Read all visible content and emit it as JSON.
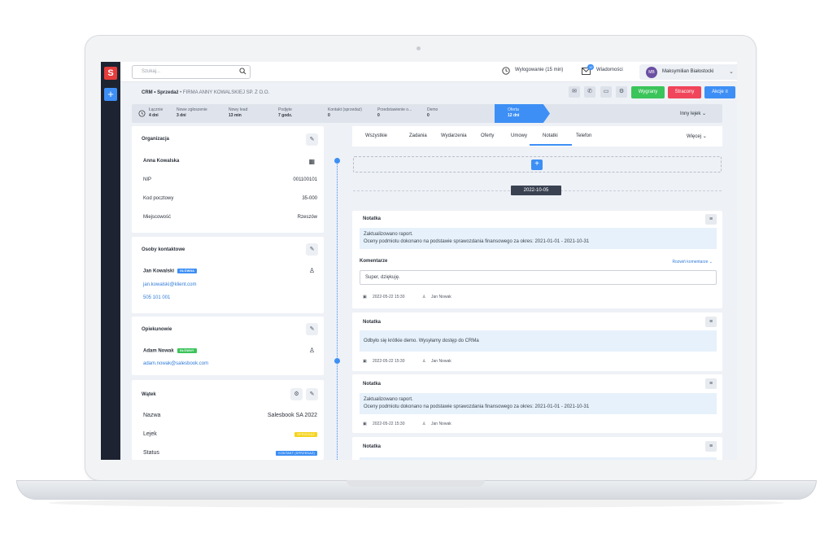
{
  "topbar": {
    "search_placeholder": "Szukaj...",
    "logout_label": "Wylogowanie (15 min)",
    "messages_label": "Wiadomości",
    "messages_badge": "12",
    "user_initials": "MB",
    "user_name": "Maksymilian Białostocki"
  },
  "breadcrumb": {
    "module": "CRM",
    "section": "Sprzedaż",
    "company": "FIRMA ANNY KOWALSKIEJ SP. Z O.O."
  },
  "actions": {
    "won": "Wygrany",
    "lost": "Stracony",
    "actions": "Akcje"
  },
  "pipeline": {
    "total_label": "Łącznie",
    "total_value": "4 dni",
    "stages": [
      {
        "label": "Nowe zgłoszenie",
        "value": "3 dni"
      },
      {
        "label": "Nowy lead",
        "value": "13 min"
      },
      {
        "label": "Podjęte",
        "value": "7 godz."
      },
      {
        "label": "Kontakt (sprzedaż)",
        "value": "0"
      },
      {
        "label": "Przedstawienie o...",
        "value": "0"
      },
      {
        "label": "Demo",
        "value": "0"
      },
      {
        "label": "Oferta",
        "value": "12 dni"
      }
    ],
    "funnel_label": "Inny lejek"
  },
  "organization": {
    "title": "Organizacja",
    "name": "Anna Kowalska",
    "fields": [
      {
        "label": "NIP",
        "value": "001100101"
      },
      {
        "label": "Kod pocztowy",
        "value": "35-000"
      },
      {
        "label": "Miejscowość",
        "value": "Rzeszów"
      }
    ]
  },
  "contacts": {
    "title": "Osoby kontaktowe",
    "name": "Jan Kowalski",
    "badge": "GŁÓWNA",
    "email": "jan.kowalski@klient.com",
    "phone": "505 101 001"
  },
  "guardians": {
    "title": "Opiekunowie",
    "name": "Adam Nowak",
    "badge": "GŁÓWNY",
    "email": "adam.nowak@salesbook.com"
  },
  "thread": {
    "title": "Wątek",
    "fields": [
      {
        "label": "Nazwa",
        "value": "Salesbook SA 2022"
      },
      {
        "label": "Lejek",
        "value": "SPRZEDAŻ"
      },
      {
        "label": "Status",
        "value": "KONTAKT (SPRZEDAŻ)"
      }
    ]
  },
  "tabs": [
    "Wszystkie",
    "Zadania",
    "Wydarzenia",
    "Oferty",
    "Umowy",
    "Notatki",
    "Telefon"
  ],
  "tabs_more": "Więcej",
  "timeline": {
    "date": "2022-10-05",
    "notes": [
      {
        "title": "Notatka",
        "body_line1": "Zaktualizowano raport.",
        "body_line2": "Oceny podmiotu dokonano na podstawie sprawozdania finansowego za okres: 2021-01-01 - 2021-10-31",
        "comments_label": "Komentarze",
        "expand_label": "Rozwiń komentarze",
        "comment": "Super, dziękuję.",
        "date": "2022-05-22 15:30",
        "author": "Jan Nowak"
      },
      {
        "title": "Notatka",
        "body_line1": "Odbyło się krótkie demo. Wysyłamy dostęp do CRMa",
        "date": "2022-05-22 15:30",
        "author": "Jan Nowak"
      },
      {
        "title": "Notatka",
        "body_line1": "Zaktualizowano raport.",
        "body_line2": "Oceny podmiotu dokonano na podstawie sprawozdania finansowego za okres: 2021-01-01 - 2021-10-31",
        "date": "2022-05-22 15:30",
        "author": "Jan Nowak"
      },
      {
        "title": "Notatka"
      }
    ]
  },
  "colors": {
    "accent": "#3d8ff5",
    "won": "#3ac45a",
    "lost": "#f0455a",
    "sidebar": "#1d2330"
  }
}
